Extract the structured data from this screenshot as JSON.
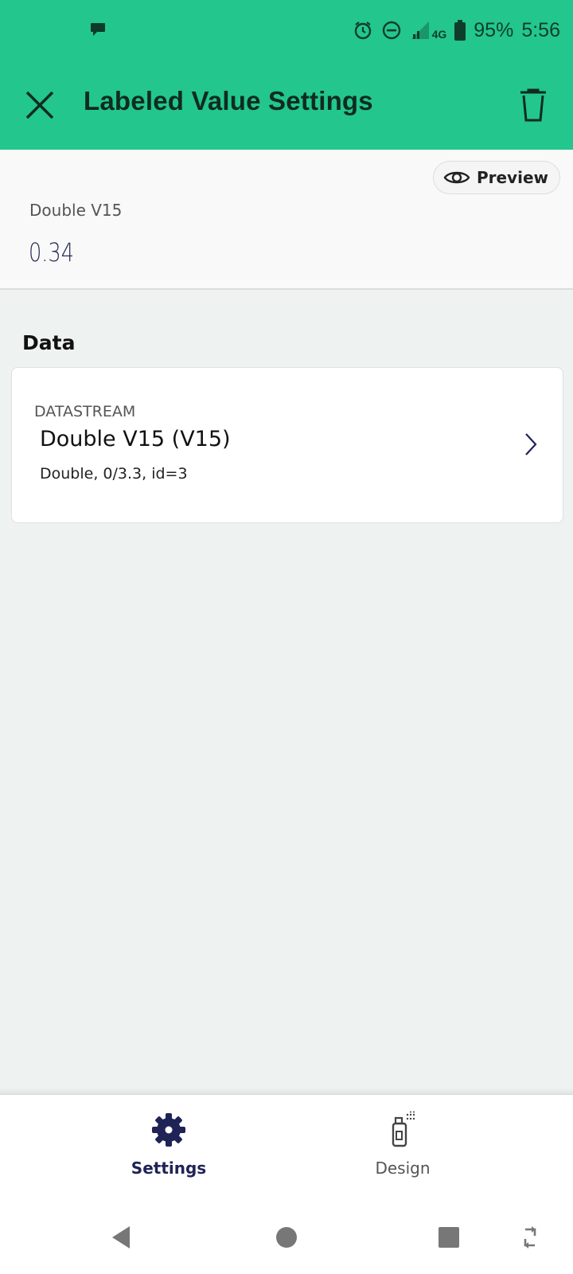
{
  "status_bar": {
    "battery": "95%",
    "time": "5:56",
    "network": "4G",
    "icons": [
      "chat-bubble-icon",
      "alarm-icon",
      "dnd-icon",
      "signal-icon",
      "battery-icon"
    ]
  },
  "app_bar": {
    "title": "Labeled Value Settings",
    "close_icon": "close-icon",
    "delete_icon": "trash-icon"
  },
  "preview": {
    "button_label": "Preview",
    "widget_label": "Double V15",
    "widget_value": "0.34"
  },
  "data_section": {
    "title": "Data",
    "datastream": {
      "kicker": "DATASTREAM",
      "name": "Double V15 (V15)",
      "details": "Double, 0/3.3, id=3"
    }
  },
  "bottom_nav": {
    "tabs": [
      {
        "label": "Settings",
        "icon": "gear-icon",
        "active": true
      },
      {
        "label": "Design",
        "icon": "spray-can-icon",
        "active": false
      }
    ]
  },
  "colors": {
    "primary": "#23c68d",
    "accent_dark": "#1f2356"
  }
}
